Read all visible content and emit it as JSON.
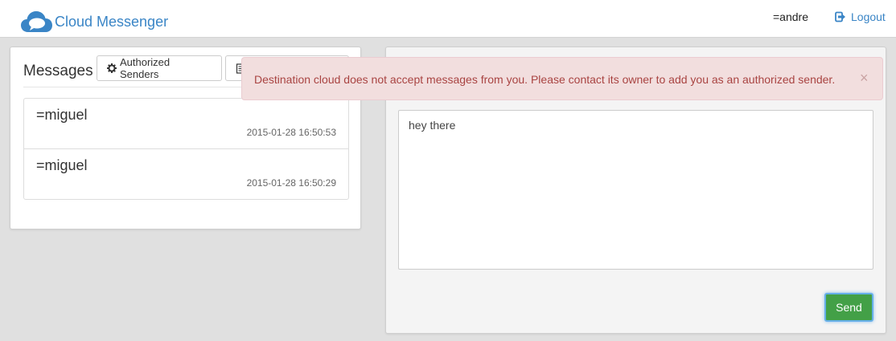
{
  "app": {
    "brand": "Cloud Messenger",
    "brand_color": "#3a85c6"
  },
  "navbar": {
    "username": "=andre",
    "logout_label": "Logout"
  },
  "messages_panel": {
    "title": "Messages",
    "authorized_senders_label": "Authorized Senders",
    "items": [
      {
        "sender": "=miguel",
        "timestamp": "2015-01-28 16:50:53"
      },
      {
        "sender": "=miguel",
        "timestamp": "2015-01-28 16:50:29"
      }
    ]
  },
  "compose": {
    "message_text": "hey there",
    "send_label": "Send",
    "send_color": "#43a047"
  },
  "alert": {
    "text": "Destination cloud does not accept messages from you. Please contact its owner to add you as an authorized sender.",
    "close_glyph": "×",
    "background": "#f2dede",
    "text_color": "#a94442"
  }
}
